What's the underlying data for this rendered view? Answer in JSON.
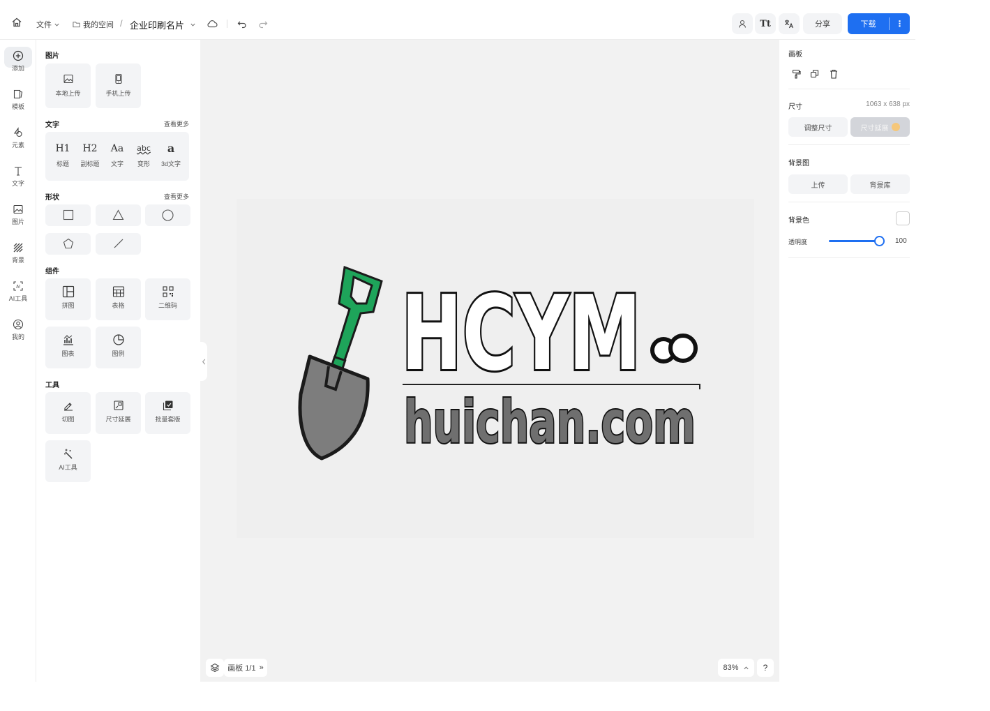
{
  "topbar": {
    "file_label": "文件",
    "space_label": "我的空间",
    "separator": "/",
    "title": "企业印刷名片",
    "share_label": "分享",
    "download_label": "下载",
    "download_more": "⋮"
  },
  "rail": [
    {
      "label": "添加",
      "icon": "plus-circle-icon"
    },
    {
      "label": "模板",
      "icon": "template-icon"
    },
    {
      "label": "元素",
      "icon": "shapes-icon"
    },
    {
      "label": "文字",
      "icon": "text-icon"
    },
    {
      "label": "图片",
      "icon": "image-icon"
    },
    {
      "label": "背景",
      "icon": "background-icon"
    },
    {
      "label": "AI工具",
      "icon": "ai-icon"
    },
    {
      "label": "我的",
      "icon": "user-icon"
    }
  ],
  "panel": {
    "images": {
      "title": "图片",
      "items": [
        {
          "label": "本地上传",
          "icon": "image-upload-icon"
        },
        {
          "label": "手机上传",
          "icon": "phone-upload-icon"
        }
      ]
    },
    "text": {
      "title": "文字",
      "more": "查看更多",
      "items": [
        {
          "glyph": "H1",
          "label": "标题"
        },
        {
          "glyph": "H2",
          "label": "副标题"
        },
        {
          "glyph": "Aa",
          "label": "文字"
        },
        {
          "glyph": "abc",
          "label": "变形"
        },
        {
          "glyph": "a",
          "label": "3d文字"
        }
      ]
    },
    "shapes": {
      "title": "形状",
      "more": "查看更多",
      "items": [
        "square-shape-icon",
        "triangle-shape-icon",
        "circle-shape-icon",
        "pentagon-shape-icon",
        "line-shape-icon"
      ]
    },
    "components": {
      "title": "组件",
      "items": [
        {
          "label": "拼图",
          "icon": "collage-icon"
        },
        {
          "label": "表格",
          "icon": "table-icon"
        },
        {
          "label": "二维码",
          "icon": "qrcode-icon"
        },
        {
          "label": "图表",
          "icon": "chart-icon"
        },
        {
          "label": "图例",
          "icon": "legend-icon"
        }
      ]
    },
    "tools": {
      "title": "工具",
      "items": [
        {
          "label": "切图",
          "icon": "cutout-icon"
        },
        {
          "label": "尺寸延展",
          "icon": "resize-extend-icon"
        },
        {
          "label": "批量套版",
          "icon": "batch-template-icon"
        },
        {
          "label": "AI工具",
          "icon": "ai-wand-icon"
        }
      ]
    }
  },
  "canvas": {
    "logo_text_top": "HCYM",
    "logo_text_bottom": "huichan.com",
    "page_label": "画板 1/1",
    "page_next": "»",
    "zoom": "83%",
    "help": "?",
    "colors": {
      "shovel_green": "#1ea45a",
      "shovel_gray": "#7d7d7d",
      "text_gray": "#6f6f6f"
    }
  },
  "rpanel": {
    "board_title": "画板",
    "size_label": "尺寸",
    "size_value": "1063 x 638 px",
    "resize_btn": "调整尺寸",
    "extend_btn": "尺寸延展",
    "bg_image_label": "背景图",
    "upload_btn": "上传",
    "library_btn": "背景库",
    "bg_color_label": "背景色",
    "opacity_label": "透明度",
    "opacity_value": "100"
  },
  "accent_color": "#1e6ff1"
}
